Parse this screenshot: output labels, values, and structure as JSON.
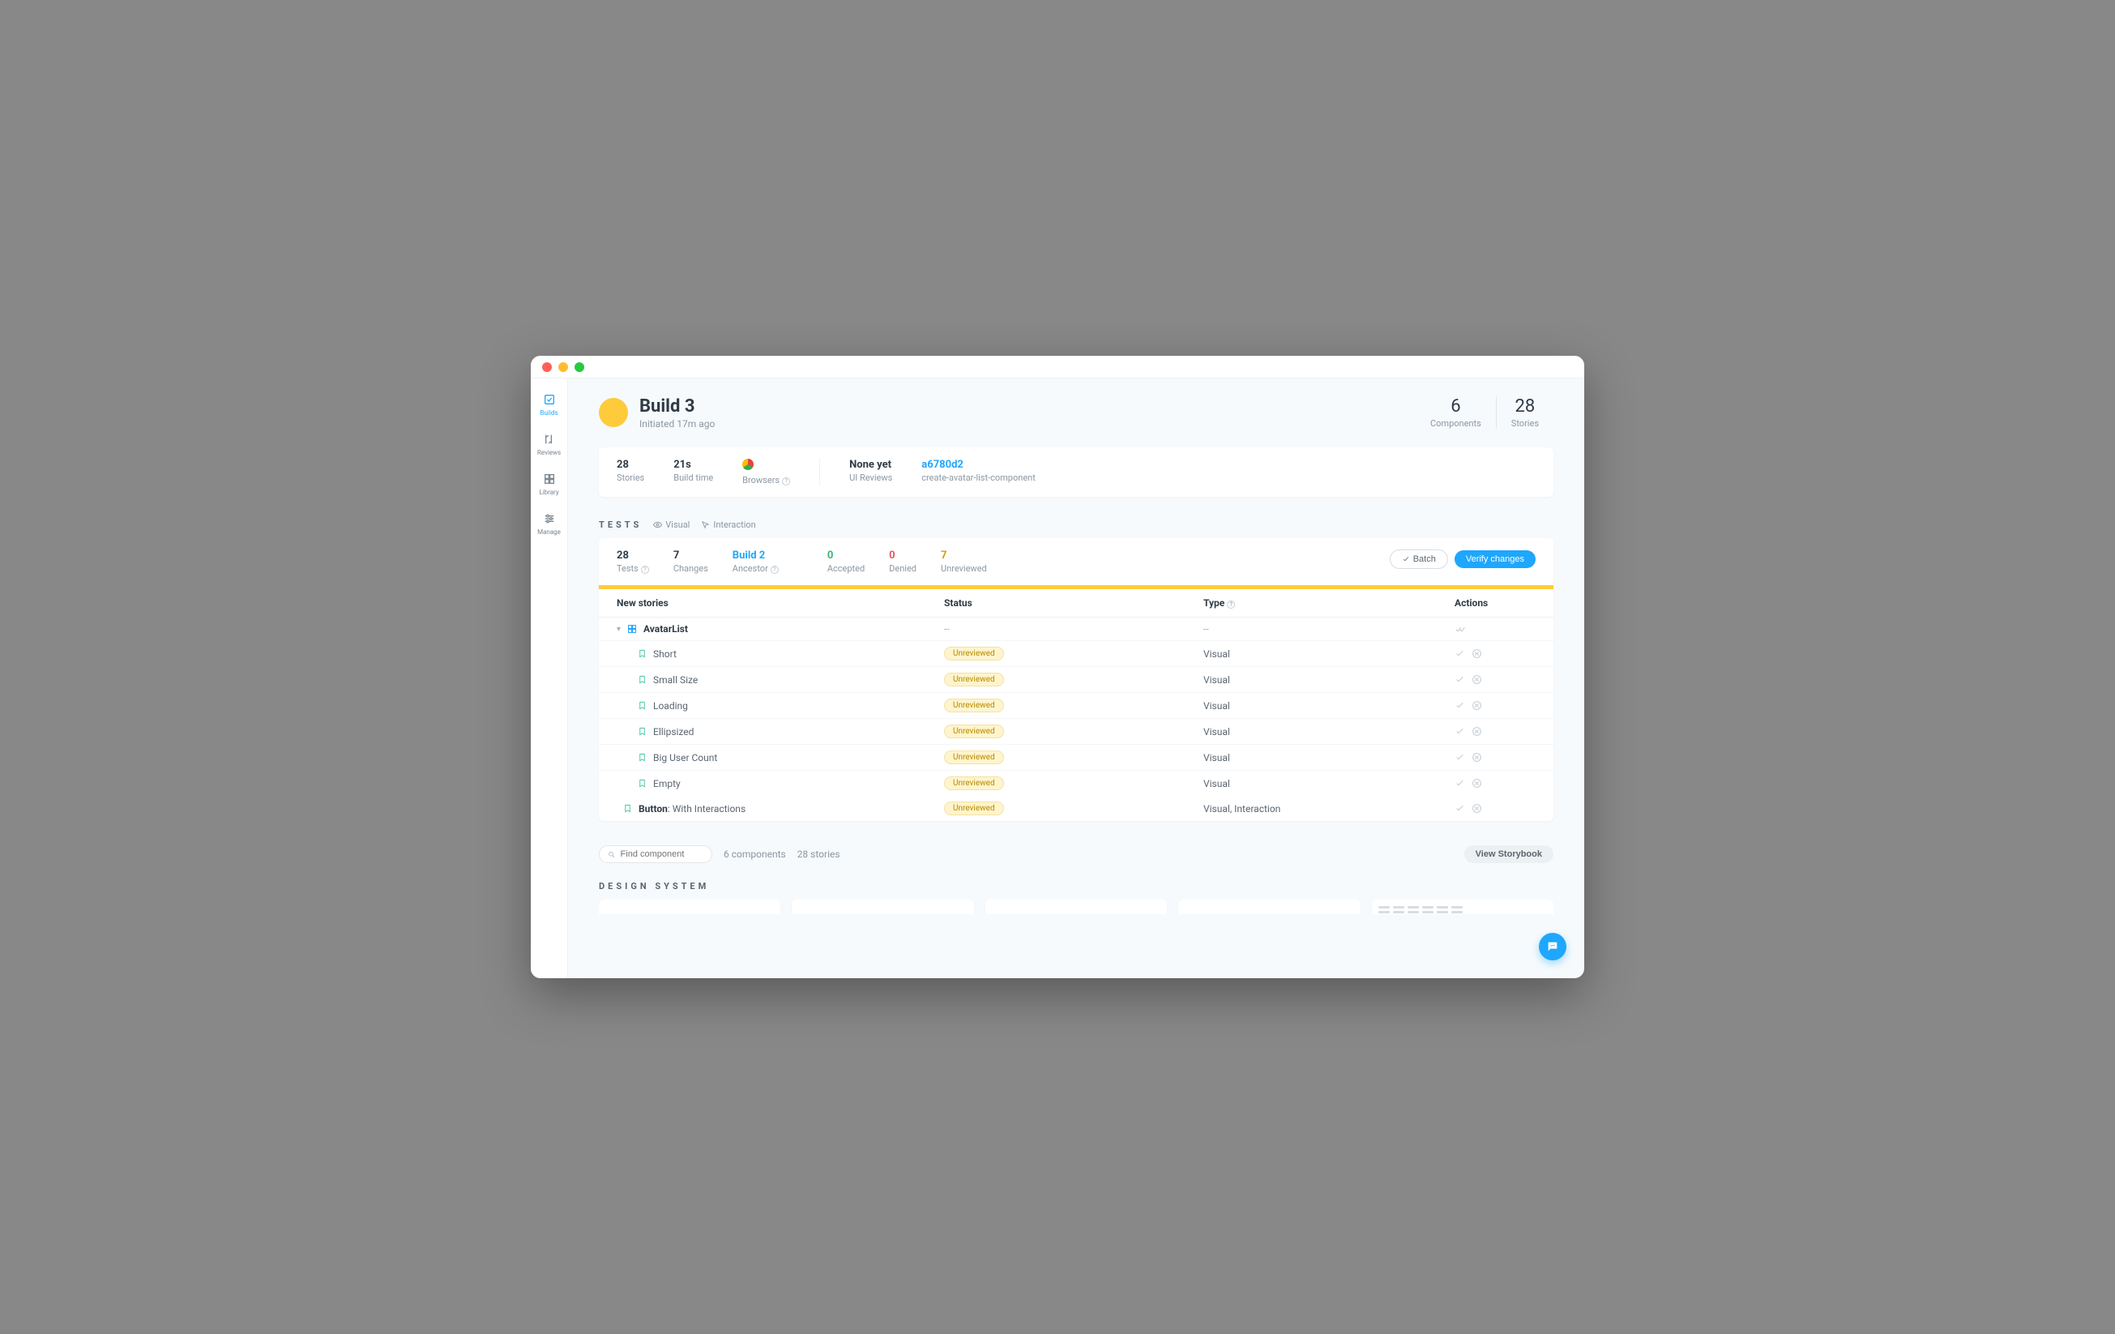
{
  "sidebar": {
    "builds": "Builds",
    "reviews": "Reviews",
    "library": "Library",
    "manage": "Manage"
  },
  "header": {
    "title": "Build 3",
    "subtitle": "Initiated 17m ago",
    "components_count": "6",
    "components_label": "Components",
    "stories_count": "28",
    "stories_label": "Stories"
  },
  "build": {
    "stories_v": "28",
    "stories_l": "Stories",
    "buildtime_v": "21s",
    "buildtime_l": "Build time",
    "browsers_l": "Browsers",
    "uireviews_v": "None yet",
    "uireviews_l": "UI Reviews",
    "commit_v": "a6780d2",
    "commit_l": "create-avatar-list-component"
  },
  "tests": {
    "title": "TESTS",
    "visual": "Visual",
    "interaction": "Interaction",
    "tests_v": "28",
    "tests_l": "Tests",
    "changes_v": "7",
    "changes_l": "Changes",
    "ancestor_v": "Build 2",
    "ancestor_l": "Ancestor",
    "accepted_v": "0",
    "accepted_l": "Accepted",
    "denied_v": "0",
    "denied_l": "Denied",
    "unreviewed_v": "7",
    "unreviewed_l": "Unreviewed",
    "batch": "Batch",
    "verify": "Verify changes"
  },
  "table": {
    "h_name": "New stories",
    "h_status": "Status",
    "h_type": "Type",
    "h_actions": "Actions",
    "comp_name": "AvatarList",
    "rows": [
      {
        "name": "Short",
        "status": "Unreviewed",
        "type": "Visual"
      },
      {
        "name": "Small Size",
        "status": "Unreviewed",
        "type": "Visual"
      },
      {
        "name": "Loading",
        "status": "Unreviewed",
        "type": "Visual"
      },
      {
        "name": "Ellipsized",
        "status": "Unreviewed",
        "type": "Visual"
      },
      {
        "name": "Big User Count",
        "status": "Unreviewed",
        "type": "Visual"
      },
      {
        "name": "Empty",
        "status": "Unreviewed",
        "type": "Visual"
      }
    ],
    "extra_bold": "Button",
    "extra_rest": ": With Interactions",
    "extra_status": "Unreviewed",
    "extra_type": "Visual, Interaction"
  },
  "footer": {
    "search_placeholder": "Find component",
    "comp_count": "6 components",
    "story_count": "28 stories",
    "view_sb": "View Storybook"
  },
  "ds": {
    "title": "DESIGN SYSTEM"
  }
}
